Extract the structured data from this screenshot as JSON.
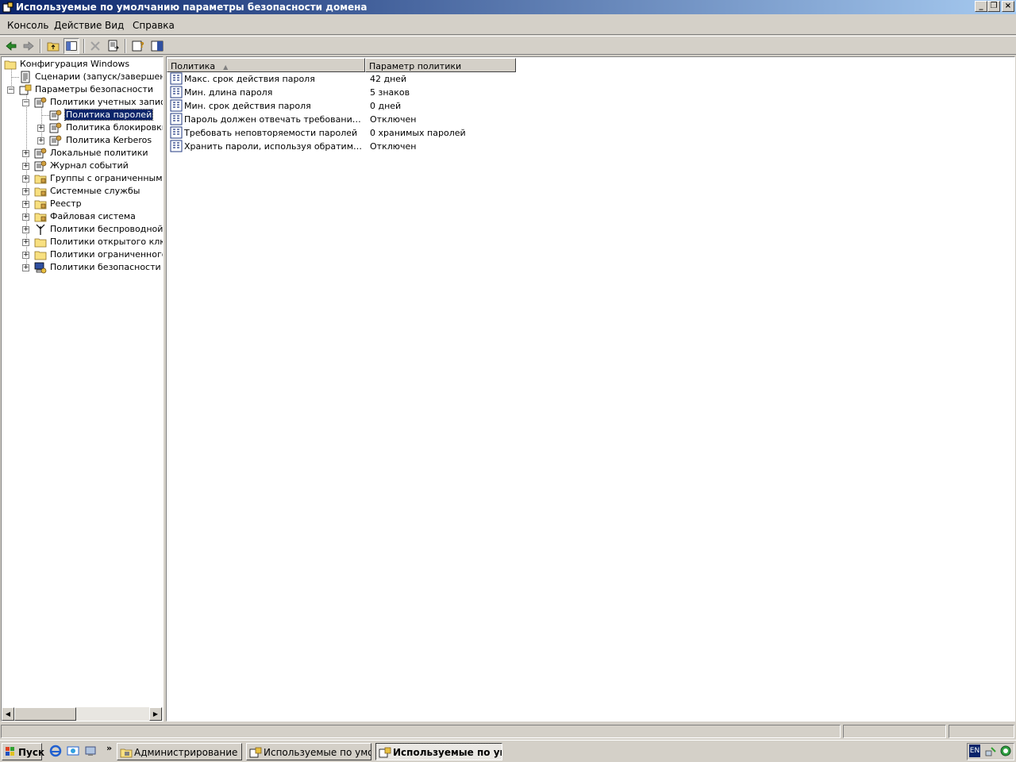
{
  "window": {
    "title": "Используемые по умолчанию параметры безопасности домена",
    "icon": "security-template-icon"
  },
  "menu": [
    {
      "label": "Консоль"
    },
    {
      "label": "Действие"
    },
    {
      "label": "Вид"
    },
    {
      "label": "Справка"
    }
  ],
  "toolbar": {
    "buttons": [
      "back-arrow-icon",
      "forward-arrow-icon",
      "up-folder-icon",
      "show-hide-tree-icon",
      "delete-icon",
      "export-list-icon",
      "help-icon",
      "properties-icon"
    ]
  },
  "tree": {
    "items": [
      {
        "label": "Конфигурация Windows",
        "icon": "folder-icon"
      },
      {
        "label": "Сценарии (запуск/завершение)",
        "icon": "script-icon"
      },
      {
        "label": "Параметры безопасности",
        "icon": "security-settings-icon"
      },
      {
        "label": "Политики учетных записей",
        "icon": "account-policy-icon"
      },
      {
        "label": "Политика паролей",
        "icon": "policy-node-icon",
        "selected": true
      },
      {
        "label": "Политика блокировки учетной записи",
        "icon": "policy-node-icon"
      },
      {
        "label": "Политика Kerberos",
        "icon": "policy-node-icon"
      },
      {
        "label": "Локальные политики",
        "icon": "policy-node-icon"
      },
      {
        "label": "Журнал событий",
        "icon": "policy-node-icon"
      },
      {
        "label": "Группы с ограниченным доступом",
        "icon": "locked-folder-icon"
      },
      {
        "label": "Системные службы",
        "icon": "locked-folder-icon"
      },
      {
        "label": "Реестр",
        "icon": "locked-folder-icon"
      },
      {
        "label": "Файловая система",
        "icon": "locked-folder-icon"
      },
      {
        "label": "Политики беспроводной сети",
        "icon": "antenna-icon"
      },
      {
        "label": "Политики открытого ключа",
        "icon": "folder-icon"
      },
      {
        "label": "Политики ограниченного использования программ",
        "icon": "folder-icon"
      },
      {
        "label": "Политики безопасности IP на Active Directory",
        "icon": "ip-security-icon"
      }
    ]
  },
  "list": {
    "columns": [
      {
        "label": "Политика",
        "sort": "ascending"
      },
      {
        "label": "Параметр политики"
      }
    ],
    "rows": [
      {
        "policy": "Макс. срок действия пароля",
        "value": "42 дней"
      },
      {
        "policy": "Мин. длина пароля",
        "value": "5 знаков"
      },
      {
        "policy": "Мин. срок действия пароля",
        "value": "0 дней"
      },
      {
        "policy": "Пароль должен отвечать требованиям сл...",
        "value": "Отключен"
      },
      {
        "policy": "Требовать неповторяемости паролей",
        "value": "0 хранимых паролей"
      },
      {
        "policy": "Хранить пароли, используя обратимое ши...",
        "value": "Отключен"
      }
    ]
  },
  "taskbar": {
    "start_label": "Пуск",
    "quick_launch": [
      "ie-icon",
      "outlook-express-icon",
      "show-desktop-icon"
    ],
    "chevron": "»",
    "tasks": [
      {
        "label": "Администрирование",
        "active": false
      },
      {
        "label": "Используемые по умол...",
        "active": false
      },
      {
        "label": "Используемые по ум...",
        "active": true
      }
    ],
    "tray": {
      "language": "EN",
      "icons": [
        "network-icon",
        "security-icon"
      ]
    }
  },
  "colors": {
    "titlebar_start": "#0a246a",
    "titlebar_end": "#a6caf0",
    "face": "#d4d0c8",
    "selection": "#0a246a"
  }
}
